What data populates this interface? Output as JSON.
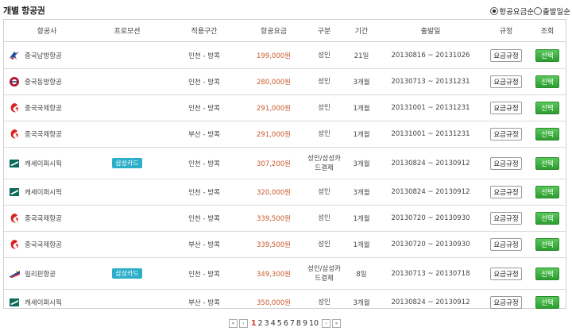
{
  "page_title": "개별 항공권",
  "sort_options": [
    {
      "label": "항공요금순",
      "selected": true
    },
    {
      "label": "출발일순",
      "selected": false
    }
  ],
  "columns": [
    "항공사",
    "프로모션",
    "적용구간",
    "항공요금",
    "구분",
    "기간",
    "출발일",
    "규정",
    "조회"
  ],
  "rules_label": "요금규정",
  "select_label": "선택",
  "rows": [
    {
      "airline": "중국남방항공",
      "logo": "china-southern-logo",
      "promo": "",
      "route": "인천 - 방콕",
      "fare": "199,000원",
      "type": "성인",
      "period": "21일",
      "dates": "20130816 ~ 20131026"
    },
    {
      "airline": "중국동방항공",
      "logo": "china-eastern-logo",
      "promo": "",
      "route": "인천 - 방콕",
      "fare": "280,000원",
      "type": "성인",
      "period": "3개월",
      "dates": "20130713 ~ 20131231"
    },
    {
      "airline": "중국국제항공",
      "logo": "air-china-logo",
      "promo": "",
      "route": "인천 - 방콕",
      "fare": "291,000원",
      "type": "성인",
      "period": "1개월",
      "dates": "20131001 ~ 20131231"
    },
    {
      "airline": "중국국제항공",
      "logo": "air-china-logo",
      "promo": "",
      "route": "부산 - 방콕",
      "fare": "291,000원",
      "type": "성인",
      "period": "1개월",
      "dates": "20131001 ~ 20131231"
    },
    {
      "airline": "캐세이퍼시픽",
      "logo": "cathay-pacific-logo",
      "promo": "삼성카드",
      "route": "인천 - 방콕",
      "fare": "307,200원",
      "type": "성인/삼성카드결제",
      "period": "3개월",
      "dates": "20130824 ~ 20130912"
    },
    {
      "airline": "캐세이퍼시픽",
      "logo": "cathay-pacific-logo",
      "promo": "",
      "route": "인천 - 방콕",
      "fare": "320,000원",
      "type": "성인",
      "period": "3개월",
      "dates": "20130824 ~ 20130912"
    },
    {
      "airline": "중국국제항공",
      "logo": "air-china-logo",
      "promo": "",
      "route": "인천 - 방콕",
      "fare": "339,500원",
      "type": "성인",
      "period": "1개월",
      "dates": "20130720 ~ 20130930"
    },
    {
      "airline": "중국국제항공",
      "logo": "air-china-logo",
      "promo": "",
      "route": "부산 - 방콕",
      "fare": "339,500원",
      "type": "성인",
      "period": "1개월",
      "dates": "20130720 ~ 20130930"
    },
    {
      "airline": "필리핀항공",
      "logo": "philippine-airlines-logo",
      "promo": "삼성카드",
      "route": "인천 - 방콕",
      "fare": "349,300원",
      "type": "성인/삼성카드결제",
      "period": "8일",
      "dates": "20130713 ~ 20130718"
    },
    {
      "airline": "캐세이퍼시픽",
      "logo": "cathay-pacific-logo",
      "promo": "",
      "route": "부산 - 방콕",
      "fare": "350,000원",
      "type": "성인",
      "period": "3개월",
      "dates": "20130824 ~ 20130912"
    }
  ],
  "pagination": {
    "pages": [
      "1",
      "2",
      "3",
      "4",
      "5",
      "6",
      "7",
      "8",
      "9",
      "10"
    ],
    "current": "1",
    "first_icon": "double-chevron-left-icon",
    "prev_icon": "chevron-left-icon",
    "next_icon": "chevron-right-icon",
    "last_icon": "double-chevron-right-icon"
  },
  "colors": {
    "fare": "#c8582a",
    "promo_badge": "#2aaec9",
    "select_button": "#3fae42",
    "active_page": "#d23b2a"
  }
}
